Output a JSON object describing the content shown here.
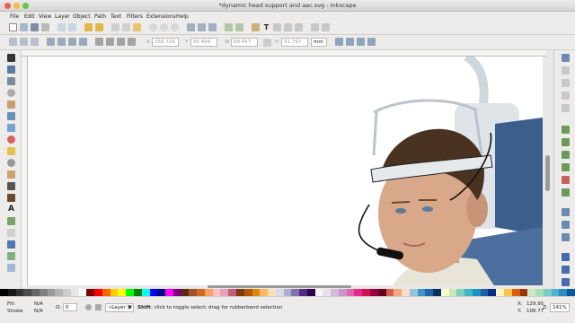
{
  "window": {
    "title": "*dynamic head support and aac.svg - Inkscape"
  },
  "menu": [
    "File",
    "Edit",
    "View",
    "Layer",
    "Object",
    "Path",
    "Text",
    "Filters",
    "Extensions",
    "Help"
  ],
  "select_toolbar": {
    "x_label": "X",
    "x_value": "356.729",
    "y_label": "Y",
    "y_value": "95.459",
    "w_label": "W",
    "w_value": "69.457",
    "h_label": "H",
    "h_value": "91.797",
    "unit": "mm"
  },
  "status": {
    "fill_label": "Fill:",
    "fill_value": "N/A",
    "stroke_label": "Stroke",
    "stroke_value": "N/A",
    "opacity_label": "O:",
    "opacity_value": "0",
    "layer": "•Layer 1",
    "message_key": "Shift",
    "message": ": click to toggle select; drag for rubberband selection",
    "x_label": "X:",
    "x_value": "129.95",
    "y_label": "Y:",
    "y_value": "106.77",
    "zoom_label": "Z:",
    "zoom_value": "141%"
  },
  "colors": {
    "close": "#ee5f57",
    "minimize": "#f6bd41",
    "maximize": "#5fc84a",
    "seat_blue": "#3b5e8c",
    "hair": "#4a3220",
    "skin": "#d9a88b"
  },
  "palette": [
    "#000000",
    "#1a1a1a",
    "#333333",
    "#4d4d4d",
    "#666666",
    "#808080",
    "#999999",
    "#b3b3b3",
    "#cccccc",
    "#e6e6e6",
    "#ffffff",
    "#800000",
    "#ff0000",
    "#ff6600",
    "#ffcc00",
    "#ffff00",
    "#00ff00",
    "#008000",
    "#00ffff",
    "#0000ff",
    "#000080",
    "#ff00ff",
    "#800080",
    "#5a2d0c",
    "#a0522d",
    "#d2691e",
    "#f4a460",
    "#ffc0cb",
    "#e8a0b4",
    "#c06080",
    "#7f3b08",
    "#b35806",
    "#e08214",
    "#fdb863",
    "#fee0b6",
    "#d8daeb",
    "#b2abd2",
    "#8073ac",
    "#542788",
    "#2d004b",
    "#f7f4f9",
    "#e7e1ef",
    "#d4b9da",
    "#c994c7",
    "#df65b0",
    "#e7298a",
    "#ce1256",
    "#980043",
    "#67001f",
    "#d6604d",
    "#f4a582",
    "#fddbc7",
    "#92c5de",
    "#4393c3",
    "#2166ac",
    "#053061",
    "#ffffcc",
    "#c7e9b4",
    "#7fcdbb",
    "#41b6c4",
    "#1d91c0",
    "#225ea8",
    "#0c2c84",
    "#fff7bc",
    "#fec44f",
    "#d95f0e",
    "#993404",
    "#ccebc5",
    "#a8ddb5",
    "#7bccc4",
    "#4eb3d3",
    "#2b8cbe",
    "#08589e"
  ]
}
